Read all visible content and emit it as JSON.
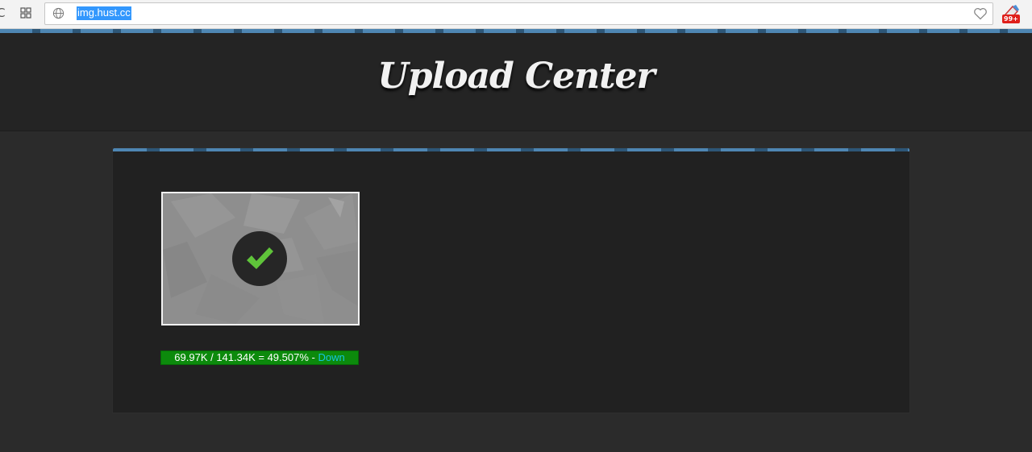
{
  "browser": {
    "url": "img.hust.cc",
    "reload_glyph": "C",
    "extension_badge": "99+",
    "icons": [
      "reload-icon",
      "apps-grid-icon",
      "globe-icon",
      "favorite-heart-icon",
      "extension-icon"
    ]
  },
  "page": {
    "title": "Upload Center"
  },
  "upload": {
    "loaded": "69.97K",
    "total": "141.34K",
    "percent": "49.507%",
    "progress_text": "69.97K / 141.34K = 49.507%",
    "separator": " - ",
    "status": "Down",
    "progress_fraction": 1.0,
    "check_icon": "checkmark-icon"
  },
  "colors": {
    "accent_stripe": "#4e86b3",
    "progress_green": "#0c8a0c",
    "status_cyan": "#16c4e0",
    "check_green": "#5fc43a"
  }
}
